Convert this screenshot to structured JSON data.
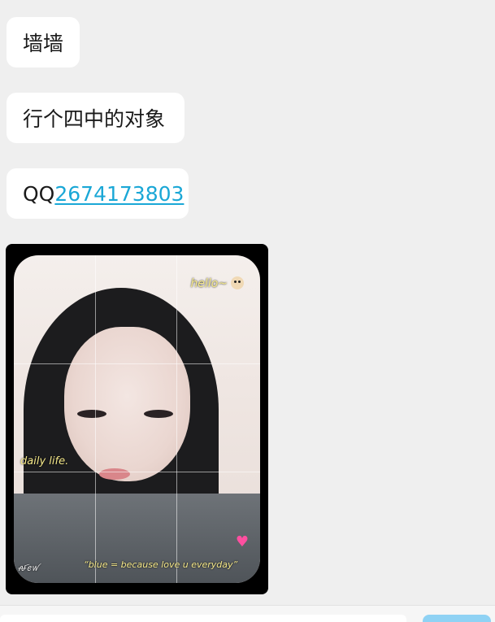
{
  "messages": [
    {
      "text": "墙墙"
    },
    {
      "text": "行个四中的对象"
    },
    {
      "prefix": "QQ",
      "link": "2674173803"
    }
  ],
  "photo": {
    "overlay": {
      "hello": "hello~",
      "daily": "daily life.",
      "caption": "“blue = because love u everyday”",
      "corner": "ꫛꫀꪝ"
    },
    "icons": [
      "dog-emoji-icon",
      "heart-emoji-icon"
    ]
  },
  "colors": {
    "background": "#efefef",
    "bubble": "#ffffff",
    "link": "#1aa7d6",
    "send_button": "#8fd2f4"
  }
}
